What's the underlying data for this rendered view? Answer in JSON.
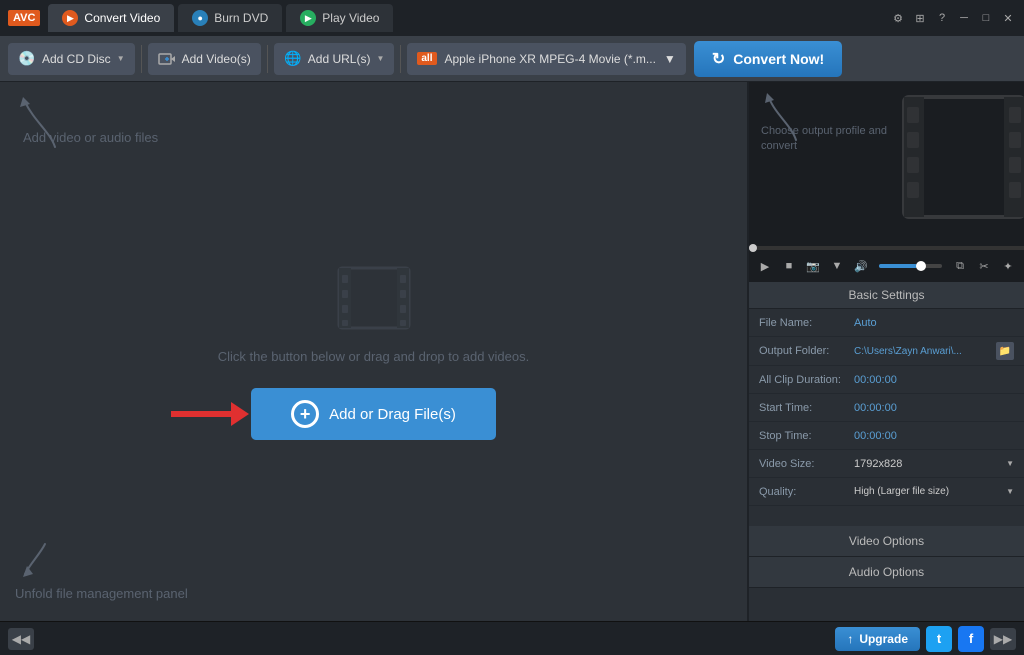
{
  "titleBar": {
    "logo": "AVC",
    "tabs": [
      {
        "id": "convert",
        "label": "Convert Video",
        "icon": "▶",
        "iconColor": "orange",
        "active": true
      },
      {
        "id": "burn",
        "label": "Burn DVD",
        "icon": "●",
        "iconColor": "blue",
        "active": false
      },
      {
        "id": "play",
        "label": "Play Video",
        "icon": "▶",
        "iconColor": "green",
        "active": false
      }
    ],
    "controls": [
      "⊞",
      "?",
      "─",
      "□",
      "✕"
    ]
  },
  "toolbar": {
    "addCdDisc": "Add CD Disc",
    "addVideos": "Add Video(s)",
    "addUrl": "Add URL(s)",
    "profileLabel": "Apple iPhone XR MPEG-4 Movie (*.m...",
    "convertNow": "Convert Now!"
  },
  "leftPanel": {
    "hintTopLeft": "Add video or audio files",
    "hintBottomLeft": "Unfold file management panel",
    "centerHint": "Click the button below or drag and drop to add videos.",
    "addDragBtn": "Add or Drag File(s)"
  },
  "rightPanel": {
    "hintRight": "Choose output profile and convert",
    "settings": {
      "title": "Basic Settings",
      "rows": [
        {
          "label": "File Name:",
          "value": "Auto",
          "type": "text"
        },
        {
          "label": "Output Folder:",
          "value": "C:\\Users\\Zayn Anwari\\...",
          "type": "folder"
        },
        {
          "label": "All Clip Duration:",
          "value": "00:00:00",
          "type": "text"
        },
        {
          "label": "Start Time:",
          "value": "00:00:00",
          "type": "text"
        },
        {
          "label": "Stop Time:",
          "value": "00:00:00",
          "type": "text"
        },
        {
          "label": "Video Size:",
          "value": "1792x828",
          "type": "dropdown"
        },
        {
          "label": "Quality:",
          "value": "High (Larger file size)",
          "type": "dropdown"
        }
      ],
      "videoOptions": "Video Options",
      "audioOptions": "Audio Options"
    }
  },
  "statusBar": {
    "upgradeBtn": "Upgrade",
    "twitterLabel": "t",
    "facebookLabel": "f"
  },
  "icons": {
    "plusCircle": "+",
    "refreshIcon": "↻",
    "playIcon": "▶",
    "stopIcon": "■",
    "cameraIcon": "📷",
    "volumeIcon": "🔊",
    "copyIcon": "⧉",
    "scissorsIcon": "✂",
    "effectsIcon": "✦",
    "leftArrow": "◀◀",
    "rightArrow": "▶▶",
    "folderIcon": "📁",
    "upgradeArrow": "↑"
  }
}
